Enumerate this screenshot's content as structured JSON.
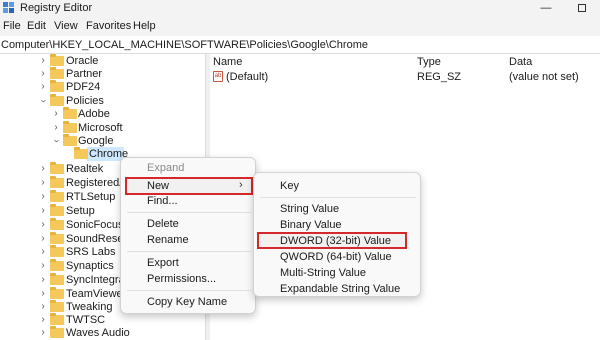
{
  "window": {
    "title": "Registry Editor",
    "minimize_glyph": "—",
    "maximize_glyph": ""
  },
  "menu": [
    "File",
    "Edit",
    "View",
    "Favorites",
    "Help"
  ],
  "address": "Computer\\HKEY_LOCAL_MACHINE\\SOFTWARE\\Policies\\Google\\Chrome",
  "tree": [
    {
      "label": "Oracle",
      "expanded": false
    },
    {
      "label": "Partner",
      "expanded": false
    },
    {
      "label": "PDF24",
      "expanded": false
    },
    {
      "label": "Policies",
      "expanded": true
    },
    {
      "label": "Adobe",
      "expanded": false
    },
    {
      "label": "Microsoft",
      "expanded": false
    },
    {
      "label": "Google",
      "expanded": true
    },
    {
      "label": "Chrome",
      "expanded": false,
      "selected": true
    },
    {
      "label": "Realtek",
      "expanded": false
    },
    {
      "label": "RegisteredAp",
      "expanded": false
    },
    {
      "label": "RTLSetup",
      "expanded": false
    },
    {
      "label": "Setup",
      "expanded": false
    },
    {
      "label": "SonicFocus",
      "expanded": false
    },
    {
      "label": "SoundResearc",
      "expanded": false
    },
    {
      "label": "SRS Labs",
      "expanded": false
    },
    {
      "label": "Synaptics",
      "expanded": false
    },
    {
      "label": "SyncIntegratio",
      "expanded": false
    },
    {
      "label": "TeamViewer",
      "expanded": false
    },
    {
      "label": "Tweaking",
      "expanded": false
    },
    {
      "label": "TWTSC",
      "expanded": false
    },
    {
      "label": "Waves Audio",
      "expanded": false
    }
  ],
  "columns": {
    "name": "Name",
    "type": "Type",
    "data": "Data"
  },
  "values": [
    {
      "name": "(Default)",
      "type": "REG_SZ",
      "data": "(value not set)",
      "icon": "ab-string-icon"
    }
  ],
  "context_menu": {
    "expand": "Expand",
    "new": "New",
    "find": "Find...",
    "delete": "Delete",
    "rename": "Rename",
    "export": "Export",
    "permissions": "Permissions...",
    "copy_key_name": "Copy Key Name",
    "submenu_arrow": "›"
  },
  "new_submenu": {
    "key": "Key",
    "string_value": "String Value",
    "binary_value": "Binary Value",
    "dword_value": "DWORD (32-bit) Value",
    "qword_value": "QWORD (64-bit) Value",
    "multi_string_value": "Multi-String Value",
    "expandable_string_value": "Expandable String Value"
  },
  "colors": {
    "highlight_border": "#d62828",
    "selection": "#cde8ff",
    "folder": "#f4c85a"
  }
}
